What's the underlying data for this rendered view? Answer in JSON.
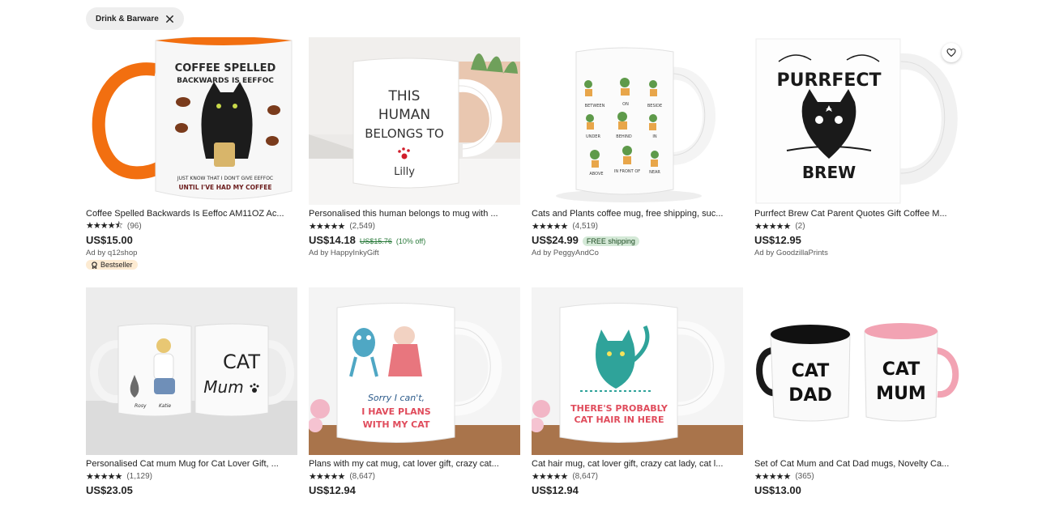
{
  "filter_chip": {
    "label": "Drink & Barware",
    "remove_icon": "close-icon"
  },
  "listings": [
    {
      "title": "Coffee Spelled Backwards Is Eeffoc AM11OZ Ac...",
      "stars": "★★★★⯪",
      "reviews": "(96)",
      "price": "US$15.00",
      "ad": "Ad by q12shop",
      "badge": "Bestseller",
      "mug_text": [
        "COFFEE SPELLED",
        "BACKWARDS IS EEFFOC",
        "JUST KNOW THAT I DON'T GIVE EEFFOC",
        "UNTIL I'VE HAD MY COFFEE"
      ]
    },
    {
      "title": "Personalised this human belongs to mug with ...",
      "stars": "★★★★★",
      "reviews": "(2,549)",
      "price": "US$14.18",
      "original_price": "US$15.76",
      "discount": "(10% off)",
      "ad": "Ad by HappyInkyGift",
      "mug_text": [
        "THIS",
        "HUMAN",
        "BELONGS TO",
        "Lilly"
      ]
    },
    {
      "title": "Cats and Plants coffee mug, free shipping, suc...",
      "stars": "★★★★★",
      "reviews": "(4,519)",
      "price": "US$24.99",
      "shipping_badge": "FREE shipping",
      "ad": "Ad by PeggyAndCo",
      "mug_text": [
        "BETWEEN",
        "ON",
        "BESIDE",
        "UNDER",
        "BEHIND",
        "IN",
        "ABOVE",
        "IN FRONT OF",
        "NEAR"
      ]
    },
    {
      "title": "Purrfect Brew Cat Parent Quotes Gift Coffee M...",
      "stars": "★★★★★",
      "reviews": "(2)",
      "price": "US$12.95",
      "ad": "Ad by GoodzillaPrints",
      "favorite_icon": "heart-icon",
      "mug_text": [
        "PURRFECT",
        "BREW"
      ]
    },
    {
      "title": "Personalised Cat mum Mug for Cat Lover Gift, ...",
      "stars": "★★★★★",
      "reviews": "(1,129)",
      "price": "US$23.05",
      "mug_text": [
        "CAT",
        "Mum",
        "Rosy",
        "Katie"
      ]
    },
    {
      "title": "Plans with my cat mug, cat lover gift, crazy cat...",
      "stars": "★★★★★",
      "reviews": "(8,647)",
      "price": "US$12.94",
      "mug_text": [
        "Sorry I can't,",
        "I HAVE PLANS",
        "WITH MY CAT"
      ]
    },
    {
      "title": "Cat hair mug, cat lover gift, crazy cat lady, cat l...",
      "stars": "★★★★★",
      "reviews": "(8,647)",
      "price": "US$12.94",
      "mug_text": [
        "THERE'S PROBABLY",
        "CAT HAIR IN HERE"
      ]
    },
    {
      "title": "Set of Cat Mum and Cat Dad mugs, Novelty Ca...",
      "stars": "★★★★★",
      "reviews": "(365)",
      "price": "US$13.00",
      "mug_text": [
        "CAT",
        "DAD",
        "CAT",
        "MUM"
      ]
    }
  ],
  "colors": {
    "chip_bg": "#eeeeee",
    "discount_green": "#2a7a3b",
    "free_shipping_bg": "#d4e9d7",
    "bestseller_bg": "#fdebd2",
    "orange_mug": "#f26f10",
    "pink_mug": "#f2a3b3"
  }
}
